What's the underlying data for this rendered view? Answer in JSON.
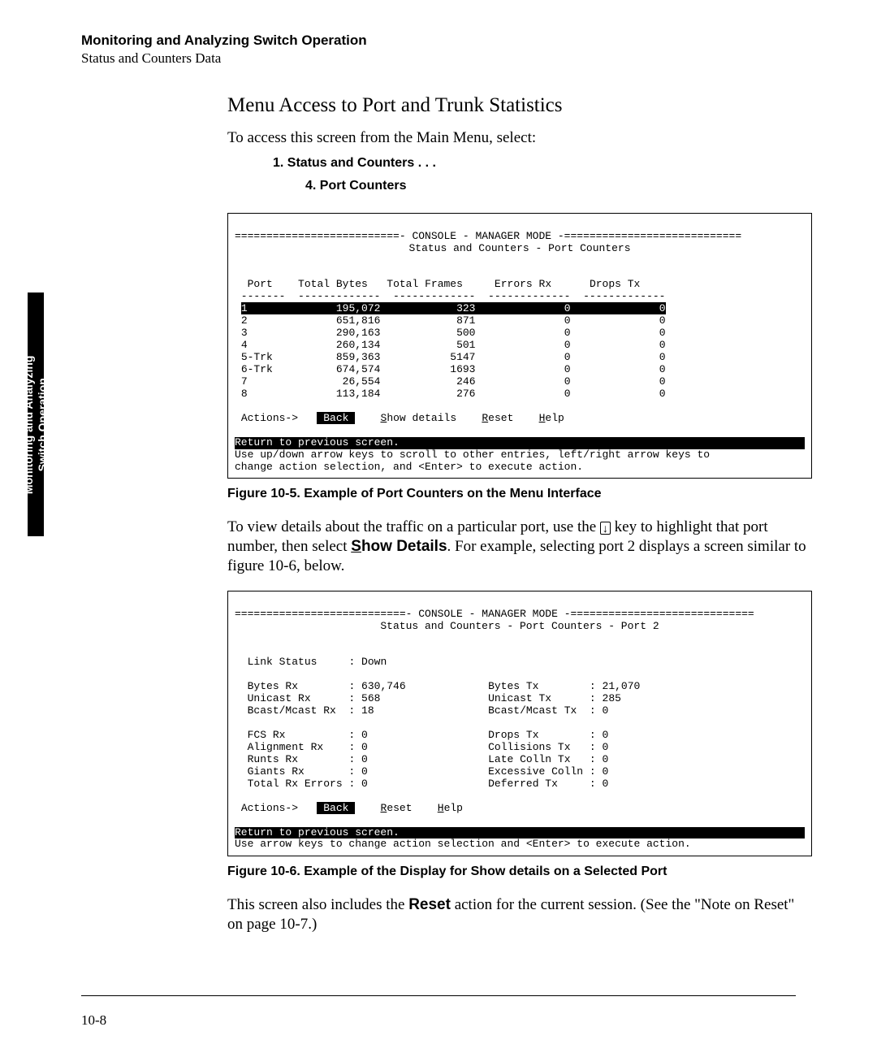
{
  "header": {
    "title": "Monitoring and Analyzing Switch Operation",
    "subtitle": "Status and Counters Data"
  },
  "sidetab": {
    "line1": "Monitoring and Analyzing",
    "line2": "Switch Operation"
  },
  "section_heading": "Menu Access to Port and Trunk Statistics",
  "intro_para": "To access this screen from the Main Menu, select:",
  "menu_steps": {
    "step1": "1. Status and Counters . . .",
    "step2": "4. Port Counters"
  },
  "console1": {
    "banner_mid": "CONSOLE - MANAGER MODE",
    "subtitle": "Status and Counters - Port Counters",
    "col_headers": [
      "Port",
      "Total Bytes",
      "Total Frames",
      "Errors Rx",
      "Drops Tx"
    ],
    "rows": [
      {
        "port": "1",
        "bytes": "195,072",
        "frames": "323",
        "errs": "0",
        "drops": "0",
        "selected": true
      },
      {
        "port": "2",
        "bytes": "651,816",
        "frames": "871",
        "errs": "0",
        "drops": "0"
      },
      {
        "port": "3",
        "bytes": "290,163",
        "frames": "500",
        "errs": "0",
        "drops": "0"
      },
      {
        "port": "4",
        "bytes": "260,134",
        "frames": "501",
        "errs": "0",
        "drops": "0"
      },
      {
        "port": "5-Trk",
        "bytes": "859,363",
        "frames": "5147",
        "errs": "0",
        "drops": "0"
      },
      {
        "port": "6-Trk",
        "bytes": "674,574",
        "frames": "1693",
        "errs": "0",
        "drops": "0"
      },
      {
        "port": "7",
        "bytes": "26,554",
        "frames": "246",
        "errs": "0",
        "drops": "0"
      },
      {
        "port": "8",
        "bytes": "113,184",
        "frames": "276",
        "errs": "0",
        "drops": "0"
      }
    ],
    "actions_label": "Actions->",
    "actions": [
      "Back",
      "Show details",
      "Reset",
      "Help"
    ],
    "return_line": "Return to previous screen.",
    "help1": "Use up/down arrow keys to scroll to other entries, left/right arrow keys to",
    "help2": "change action selection, and <Enter> to execute action."
  },
  "fig1_caption": "Figure 10-5.  Example of Port Counters on the Menu Interface",
  "para_mid_1": "To view details about the traffic on a particular port, use the ",
  "para_mid_key": "↓",
  "para_mid_2": " key to highlight that port number, then select ",
  "para_mid_bold": "Show Details",
  "para_mid_3": ". For example, selecting port 2 displays a screen similar to figure 10-6, below.",
  "console2": {
    "banner_mid": "CONSOLE - MANAGER MODE",
    "subtitle": "Status and Counters - Port Counters - Port 2",
    "link_label": "Link Status",
    "link_value": "Down",
    "stats_left": [
      {
        "label": "Bytes Rx",
        "value": "630,746"
      },
      {
        "label": "Unicast Rx",
        "value": "568"
      },
      {
        "label": "Bcast/Mcast Rx",
        "value": "18"
      }
    ],
    "stats_right": [
      {
        "label": "Bytes Tx",
        "value": "21,070"
      },
      {
        "label": "Unicast Tx",
        "value": "285"
      },
      {
        "label": "Bcast/Mcast Tx",
        "value": "0"
      }
    ],
    "errs_left": [
      {
        "label": "FCS Rx",
        "value": "0"
      },
      {
        "label": "Alignment Rx",
        "value": "0"
      },
      {
        "label": "Runts Rx",
        "value": "0"
      },
      {
        "label": "Giants Rx",
        "value": "0"
      },
      {
        "label": "Total Rx Errors",
        "value": "0"
      }
    ],
    "errs_right": [
      {
        "label": "Drops Tx",
        "value": "0"
      },
      {
        "label": "Collisions Tx",
        "value": "0"
      },
      {
        "label": "Late Colln Tx",
        "value": "0"
      },
      {
        "label": "Excessive Colln",
        "value": "0"
      },
      {
        "label": "Deferred Tx",
        "value": "0"
      }
    ],
    "actions_label": "Actions->",
    "actions": [
      "Back",
      "Reset",
      "Help"
    ],
    "return_line": "Return to previous screen.",
    "help1": "Use arrow keys to change action selection and <Enter> to execute action."
  },
  "fig2_caption": "Figure 10-6.  Example of the Display for Show details on a Selected Port",
  "para_end_1": "This screen also includes the ",
  "para_end_bold": "Reset",
  "para_end_2": " action for the current session. (See the \"Note on Reset\" on page 10-7.)",
  "page_number": "10-8"
}
